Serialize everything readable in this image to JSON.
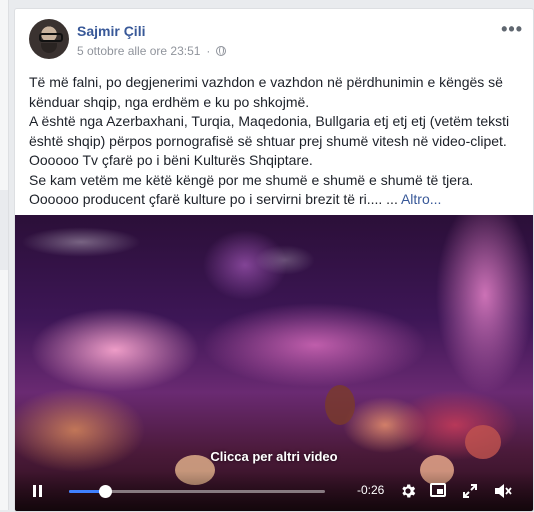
{
  "post": {
    "author": "Sajmir Çili",
    "date": "5 ottobre alle ore 23:51",
    "more_label": "•••",
    "text_lines": [
      "Të më falni, po degjenerimi vazhdon e vazhdon në përdhunimin e këngës së",
      "kënduar shqip, nga erdhëm e ku po shkojmë.",
      "A është nga Azerbaxhani, Turqia, Maqedonia, Bullgaria etj etj etj (vetëm teksti",
      "është shqip) përpos pornografisë së shtuar prej shumë vitesh në video-clipet.",
      "Oooooo Tv çfarë po i bëni Kulturës Shqiptare.",
      "Se kam vetëm me këtë këngë por me shumë e shumë e shumë të tjera."
    ],
    "last_line": "Oooooo producent çfarë kulture po i servirni brezit të ri.... ...",
    "see_more": "Altro..."
  },
  "video": {
    "overlay_label": "Clicca per altri video",
    "time_remaining": "-0:26",
    "progress_fraction": 0.14
  },
  "colors": {
    "link": "#385898",
    "progress": "#4080ff"
  },
  "icons": [
    "globe-icon",
    "more-icon",
    "pause-icon",
    "settings-icon",
    "picture-in-picture-icon",
    "fullscreen-icon",
    "volume-icon"
  ]
}
